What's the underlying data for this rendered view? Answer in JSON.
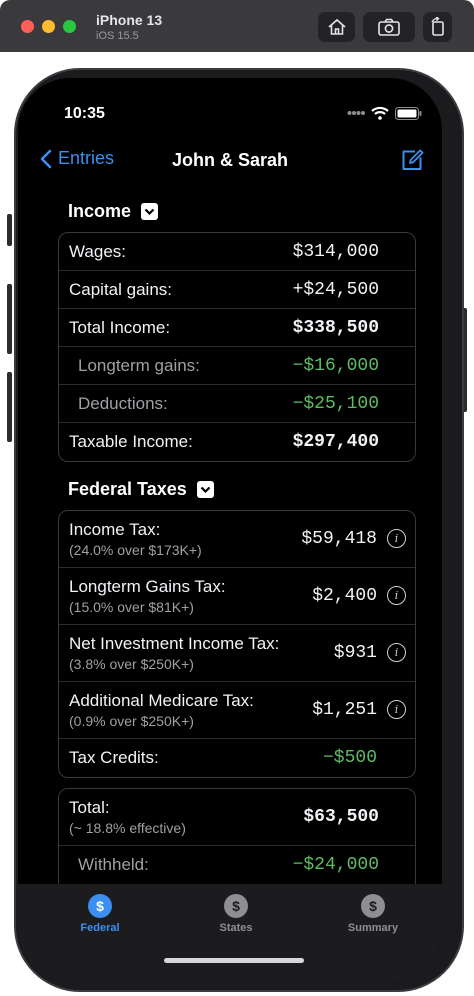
{
  "simulator": {
    "title": "iPhone 13",
    "subtitle": "iOS 15.5"
  },
  "status": {
    "time": "10:35"
  },
  "nav": {
    "back_label": "Entries",
    "title": "John & Sarah"
  },
  "income": {
    "header": "Income",
    "rows": [
      {
        "label": "Wages:",
        "value": "$314,000"
      },
      {
        "label": "Capital gains:",
        "value": "+$24,500"
      },
      {
        "label": "Total Income:",
        "value": "$338,500"
      },
      {
        "label": "Longterm gains:",
        "value": "−$16,000"
      },
      {
        "label": "Deductions:",
        "value": "−$25,100"
      },
      {
        "label": "Taxable Income:",
        "value": "$297,400"
      }
    ]
  },
  "federal": {
    "header": "Federal Taxes",
    "rows": [
      {
        "label": "Income Tax:",
        "sub": "(24.0% over $173K+)",
        "value": "$59,418"
      },
      {
        "label": "Longterm Gains Tax:",
        "sub": "(15.0% over $81K+)",
        "value": "$2,400"
      },
      {
        "label": "Net Investment Income Tax:",
        "sub": "(3.8% over $250K+)",
        "value": "$931"
      },
      {
        "label": "Additional Medicare Tax:",
        "sub": "(0.9% over $250K+)",
        "value": "$1,251"
      },
      {
        "label": "Tax Credits:",
        "value": "−$500"
      }
    ],
    "info_glyph": "i"
  },
  "total": {
    "label": "Total:",
    "sub": "(~ 18.8% effective)",
    "value": "$63,500",
    "withheld_label": "Withheld:",
    "withheld_value": "−$24,000"
  },
  "tabs": [
    {
      "label": "Federal",
      "glyph": "$",
      "active": true
    },
    {
      "label": "States",
      "glyph": "$",
      "active": false
    },
    {
      "label": "Summary",
      "glyph": "$",
      "active": false
    }
  ],
  "colors": {
    "accent": "#3b8ff0",
    "negative_green": "#5dbb63",
    "background": "#000000",
    "inactive_tab": "#8e8e93"
  }
}
